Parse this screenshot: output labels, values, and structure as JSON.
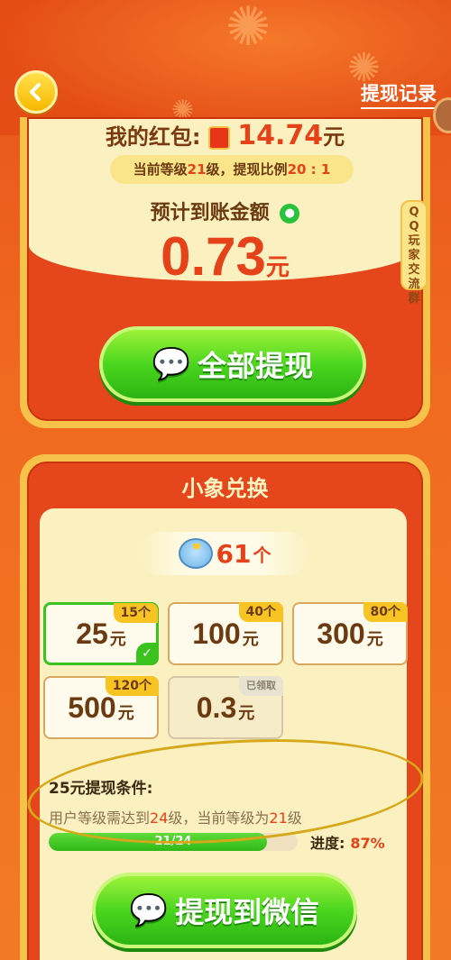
{
  "header": {
    "history_label": "提现记录"
  },
  "top_card": {
    "hongbao_label": "我的红包:",
    "hongbao_amount": "14.74",
    "hongbao_unit": "元",
    "level_prefix": "当前等级",
    "level_value": "21",
    "level_mid": "级，提现比例",
    "ratio": "20 : 1",
    "expect_label": "预计到账金额",
    "expect_amount": "0.73",
    "expect_unit": "元",
    "withdraw_all_label": "全部提现",
    "qq_group_label": "QQ玩家交流群"
  },
  "exchange": {
    "title": "小象兑换",
    "elephant_count": "61",
    "elephant_unit": "个",
    "options": [
      {
        "value": "25",
        "unit": "元",
        "cost": "15个",
        "selected": true
      },
      {
        "value": "100",
        "unit": "元",
        "cost": "40个"
      },
      {
        "value": "300",
        "unit": "元",
        "cost": "80个"
      },
      {
        "value": "500",
        "unit": "元",
        "cost": "120个"
      },
      {
        "value": "0.3",
        "unit": "元",
        "cost": "已领取",
        "claimed": true
      }
    ],
    "condition_title": "25元提现条件:",
    "condition_desc_1": "用户等级需达到",
    "condition_need": "24",
    "condition_desc_2": "级，当前等级为",
    "condition_current": "21",
    "condition_desc_3": "级",
    "progress_text": "21/24",
    "progress_fraction": 0.875,
    "progress_label": "进度:",
    "progress_pct": "87%",
    "withdraw_wechat_label": "提现到微信"
  },
  "colors": {
    "accent_red": "#e5421a",
    "green_button": "#4bd61e",
    "gold": "#f7c24a"
  },
  "icons": {
    "back": "chevron-left-icon",
    "wechat": "wechat-icon",
    "hongbao": "hongbao-icon",
    "elephant": "elephant-icon",
    "check": "check-icon"
  }
}
